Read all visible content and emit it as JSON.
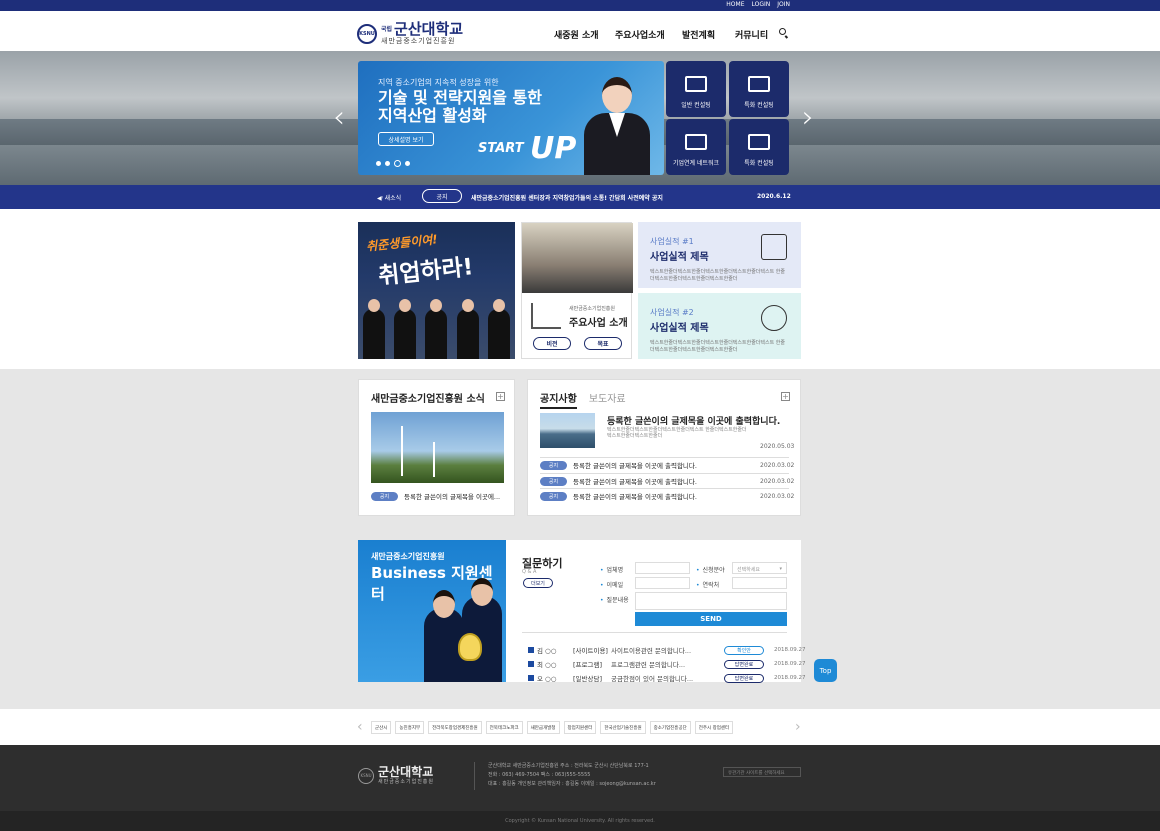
{
  "topbar": {
    "links": [
      "HOME",
      "LOGIN",
      "JOIN"
    ]
  },
  "header": {
    "logo_emblem": "KSNU",
    "logo_small": "국립",
    "logo_title": "군산대학교",
    "logo_sub": "새만금중소기업진흥원",
    "nav": [
      "새중원 소개",
      "주요사업소개",
      "발전계획",
      "커뮤니티"
    ]
  },
  "hero": {
    "banner_sub": "지역 중소기업의 지속적 성장을 위한",
    "banner_title_1": "기술 및 전략지원을 통한",
    "banner_title_2": "지역산업 활성화",
    "banner_button": "상세설명 보기",
    "banner_start": "START",
    "banner_up": "UP",
    "tiles": [
      "일반 컨설팅",
      "특화 컨설팅",
      "기업연계 네트워크",
      "특화 컨설팅"
    ]
  },
  "ticker": {
    "label": "새소식",
    "badge": "공지",
    "text": "새만금중소기업진흥원 센터장과 지역창업가들의 소통! 간담회 사전예약 공지",
    "date": "2020.6.12"
  },
  "section1": {
    "job_line1": "취준생들이여!",
    "job_line2": "취업하라!",
    "biz_sub": "새만금중소기업진흥원",
    "biz_title": "주요사업 소개",
    "biz_btn1": "비전",
    "biz_btn2": "목표",
    "perf": [
      {
        "num": "사업실적 #1",
        "title": "사업실적 제목",
        "desc": "텍스트한줄더텍스트한줄더텍스트한줄더텍스트한줄더텍스트 한줄더텍스트한줄더텍스트한줄더텍스트한줄더"
      },
      {
        "num": "사업실적 #2",
        "title": "사업실적 제목",
        "desc": "텍스트한줄더텍스트한줄더텍스트한줄더텍스트한줄더텍스트 한줄더텍스트한줄더텍스트한줄더텍스트한줄더"
      }
    ]
  },
  "news": {
    "title": "새만금중소기업진흥원 소식",
    "item_tag": "공지",
    "item_text": "등록한 글쓴이의 글제목을 이곳에..."
  },
  "notice": {
    "tab_active": "공지사항",
    "tab_other": "보도자료",
    "feature_title": "등록한 글쓴이의 글제목을 이곳에 출력합니다.",
    "feature_desc": "텍스트한줄더텍스트한줄더텍스트한줄더텍스트 한줄더텍스트한줄더텍스트한줄더텍스트한줄더",
    "feature_date": "2020.05.03",
    "rows": [
      {
        "tag": "공지",
        "text": "등록한 글쓴이의 글제목을 이곳에 출력합니다.",
        "date": "2020.03.02"
      },
      {
        "tag": "공지",
        "text": "등록한 글쓴이의 글제목을 이곳에 출력합니다.",
        "date": "2020.03.02"
      },
      {
        "tag": "공지",
        "text": "등록한 글쓴이의 글제목을 이곳에 출력합니다.",
        "date": "2020.03.02"
      }
    ]
  },
  "business": {
    "sub": "새만금중소기업진흥원",
    "title": "Business 지원센터"
  },
  "question": {
    "title": "질문하기",
    "qa": "Q & A",
    "more": "더보기",
    "labels": {
      "company": "업체명",
      "field": "신청분야",
      "email": "이메일",
      "contact": "연락처",
      "content": "질문내용"
    },
    "field_placeholder": "선택하세요",
    "send": "SEND",
    "rows": [
      {
        "name": "김 ○○",
        "cat": "[사이트이용]",
        "q": "사이트이용관련 문의합니다...",
        "status": "확인안",
        "date": "2018.09.27"
      },
      {
        "name": "최 ○○",
        "cat": "[프로그램]",
        "q": "프로그램관련 문의합니다...",
        "status": "답변완료",
        "date": "2018.09.27"
      },
      {
        "name": "오 ○○",
        "cat": "[일반상담]",
        "q": "궁금한점이 있어 문의합니다...",
        "status": "답변완료",
        "date": "2018.09.27"
      }
    ]
  },
  "top_button": "Top",
  "partners": [
    "군산시",
    "농진흥지부",
    "전라북도창업경제진흥원",
    "전북테크노파크",
    "새만금개발청",
    "창업지원센터",
    "한국산업기술진흥원",
    "중소기업진흥공단",
    "전주시 창업센터"
  ],
  "footer": {
    "logo_emblem": "KSNU",
    "logo_title": "군산대학교",
    "logo_sub": "새만금중소기업진흥원",
    "info_1": "군산대학교 새만금중소기업진흥원    주소 : 전라북도 군산시 산단남북로 177-1",
    "info_2": "전화 : 063) 469-7504    팩스 : 063)555-5555",
    "info_3": "대표 : 홍길동    개인정보 관리책임자 : 홍길동    이메일 : sojeong@kunsan.ac.kr",
    "family": "유관기관 사이트를 선택하세요",
    "copyright": "Copyright © Kunsan National University. All rights reserved."
  }
}
